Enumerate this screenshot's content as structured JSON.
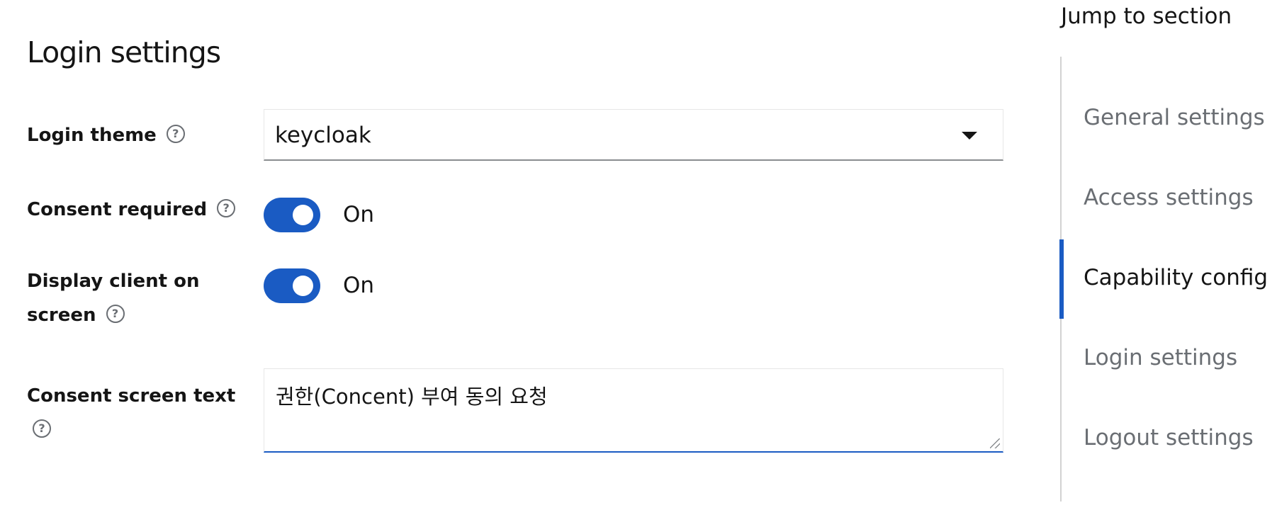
{
  "section": {
    "title": "Login settings"
  },
  "fields": {
    "login_theme": {
      "label": "Login theme",
      "value": "keycloak"
    },
    "consent_required": {
      "label": "Consent required",
      "state_label": "On"
    },
    "display_client": {
      "label_line1": "Display client on",
      "label_line2": "screen",
      "state_label": "On"
    },
    "consent_text": {
      "label_line1": "Consent screen text",
      "value": "권한(Concent) 부여 동의 요청"
    }
  },
  "jump": {
    "title": "Jump to section",
    "items": [
      {
        "label": "General settings"
      },
      {
        "label": "Access settings"
      },
      {
        "label": "Capability config"
      },
      {
        "label": "Login settings"
      },
      {
        "label": "Logout settings"
      }
    ],
    "active_index": 2
  },
  "colors": {
    "accent": "#1a5bc3",
    "help_icon": "#6a6e73",
    "muted_text": "#6a6e73"
  },
  "icons": {
    "help": "help-circle-icon",
    "caret": "caret-down-icon"
  }
}
